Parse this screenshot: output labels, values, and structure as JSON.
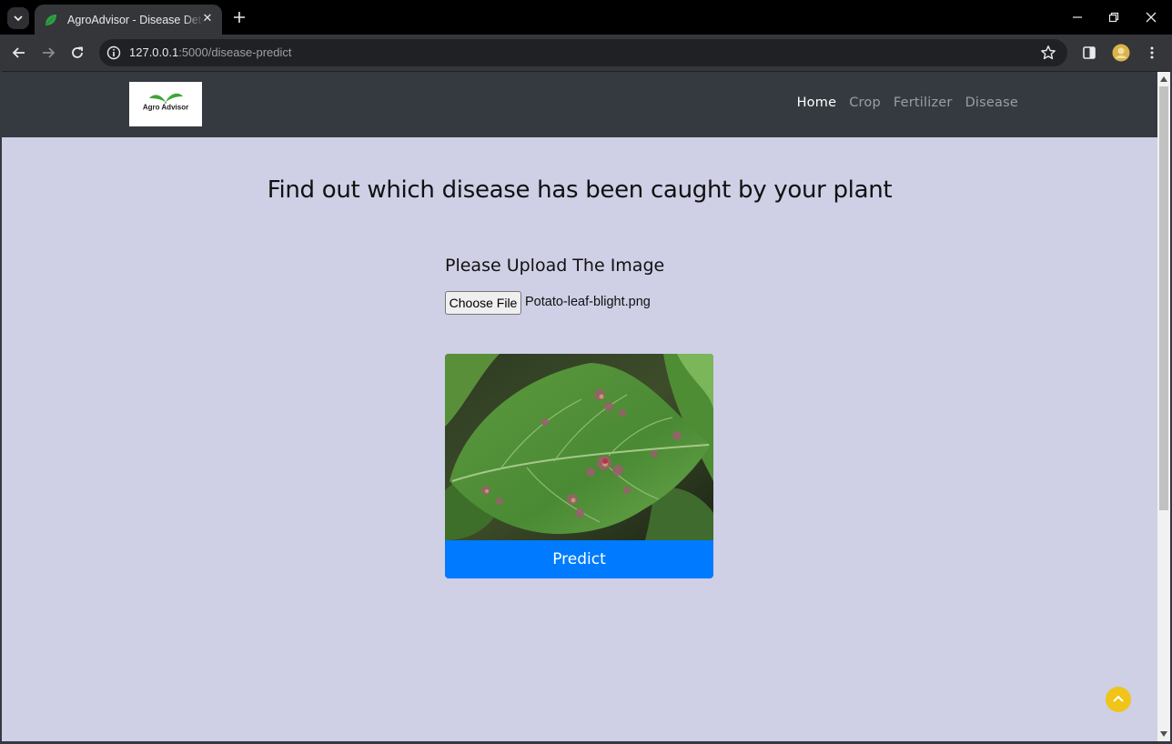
{
  "browser": {
    "tab_title": "AgroAdvisor - Disease Detection",
    "url_host": "127.0.0.1",
    "url_rest": ":5000/disease-predict",
    "icons": {
      "tab_search": "chevron-down-icon",
      "close_tab": "close-icon",
      "new_tab": "plus-icon",
      "back": "arrow-left-icon",
      "forward": "arrow-right-icon",
      "reload": "reload-icon",
      "site_info": "info-icon",
      "bookmark": "star-icon",
      "side_panel": "side-panel-icon",
      "profile": "avatar",
      "menu": "kebab-menu-icon"
    }
  },
  "navbar": {
    "brand_text": "Agro Advisor",
    "links": [
      {
        "label": "Home",
        "active": true
      },
      {
        "label": "Crop",
        "active": false
      },
      {
        "label": "Fertilizer",
        "active": false
      },
      {
        "label": "Disease",
        "active": false
      }
    ]
  },
  "main": {
    "heading": "Find out which disease has been caught by your plant",
    "upload_label": "Please Upload The Image",
    "choose_file_label": "Choose File",
    "file_name": "Potato-leaf-blight.png",
    "predict_label": "Predict"
  },
  "colors": {
    "page_bg": "#cfcfe6",
    "navbar_bg": "#343a40",
    "primary": "#007bff",
    "scroll_top": "#f0c419"
  }
}
